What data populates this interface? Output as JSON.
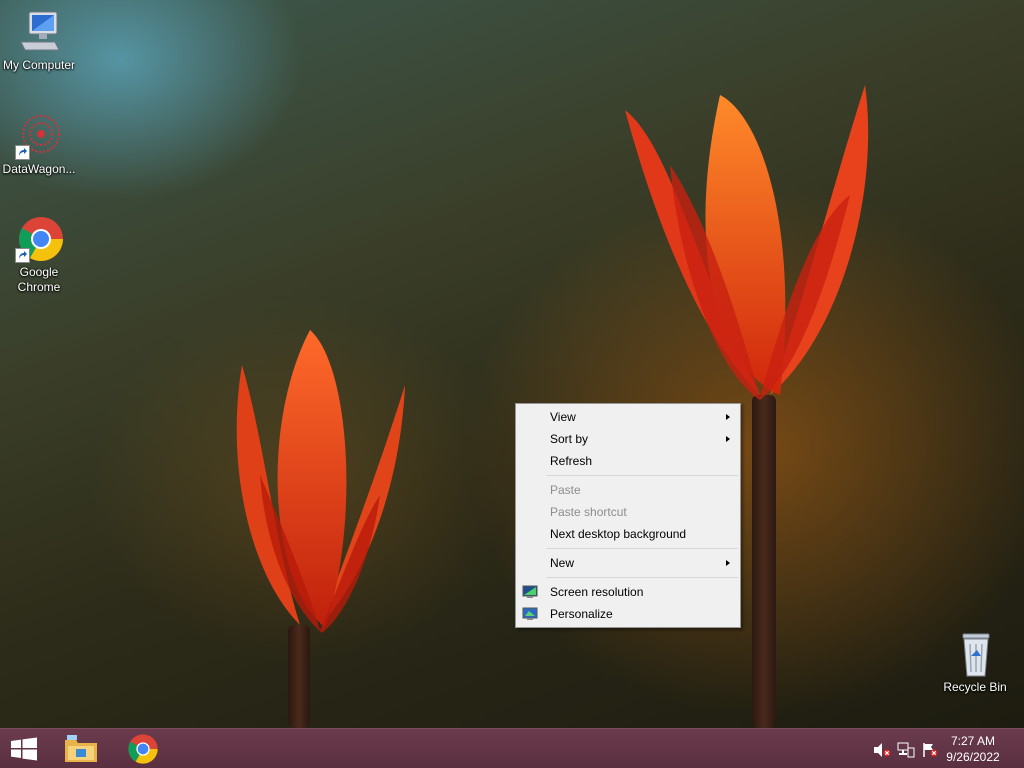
{
  "desktop": {
    "icons": [
      {
        "label": "My Computer",
        "icon": "computer-icon"
      },
      {
        "label": "DataWagon...",
        "icon": "datawagon-icon"
      },
      {
        "label": "Google Chrome",
        "icon": "chrome-icon"
      },
      {
        "label": "Recycle Bin",
        "icon": "recycle-bin-icon"
      }
    ]
  },
  "context_menu": {
    "items": {
      "view": "View",
      "sort_by": "Sort by",
      "refresh": "Refresh",
      "paste": "Paste",
      "paste_shortcut": "Paste shortcut",
      "next_background": "Next desktop background",
      "new": "New",
      "screen_resolution": "Screen resolution",
      "personalize": "Personalize"
    }
  },
  "taskbar": {
    "pinned": [
      "start-icon",
      "file-explorer-icon",
      "chrome-icon"
    ],
    "tray_icons": [
      "speaker-muted-icon",
      "network-icon",
      "action-center-icon"
    ],
    "time": "7:27 AM",
    "date": "9/26/2022"
  },
  "colors": {
    "taskbar": "#5a2f40",
    "menu_bg": "#f0f0f0"
  }
}
